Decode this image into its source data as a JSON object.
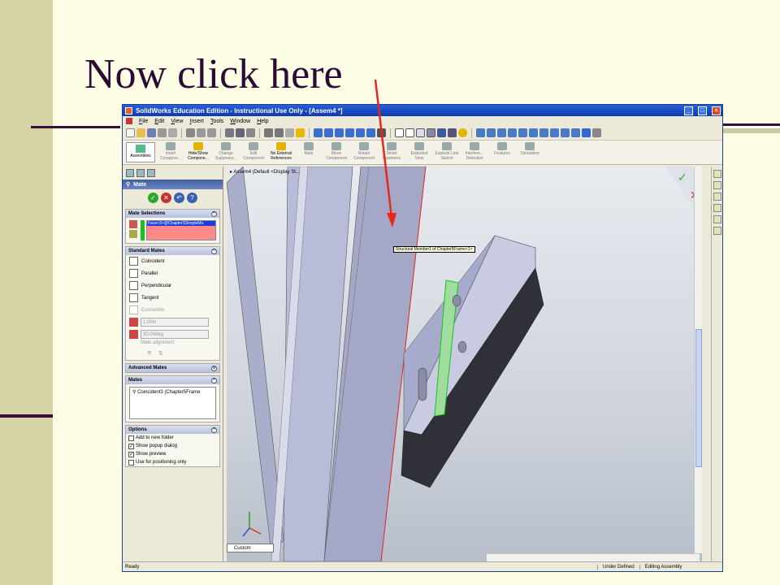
{
  "slide": {
    "title": "Now click here"
  },
  "window": {
    "title": "SolidWorks Education Edition - Instructional Use Only - [Assem4 *]",
    "min": "_",
    "max": "□",
    "close": "×"
  },
  "menu": [
    "File",
    "Edit",
    "View",
    "Insert",
    "Tools",
    "Window",
    "Help"
  ],
  "command_manager": {
    "assemblies": "Assemblies",
    "buttons": [
      {
        "label": "Insert Compone...",
        "active": false
      },
      {
        "label": "Hide/Show Compone...",
        "active": true
      },
      {
        "label": "Change Suppressi...",
        "active": false
      },
      {
        "label": "Edit Component",
        "active": false
      },
      {
        "label": "No External References",
        "active": true
      },
      {
        "label": "Mate",
        "active": false
      },
      {
        "label": "Move Component",
        "active": false
      },
      {
        "label": "Rotate Component",
        "active": false
      },
      {
        "label": "Smart Fasteners",
        "active": false
      },
      {
        "label": "Exploded View",
        "active": false
      },
      {
        "label": "Explode Line Sketch",
        "active": false
      },
      {
        "label": "Interfere... Detection",
        "active": false
      },
      {
        "label": "Features",
        "active": false
      },
      {
        "label": "Simulation",
        "active": false
      }
    ]
  },
  "property_manager": {
    "title": "Mate",
    "mate_selections": {
      "header": "Mate Selections",
      "item": "Face<3>@ChapterSSimpleMa"
    },
    "standard_mates": {
      "header": "Standard Mates",
      "items": [
        {
          "label": "Coincident",
          "enabled": true
        },
        {
          "label": "Parallel",
          "enabled": true
        },
        {
          "label": "Perpendicular",
          "enabled": true
        },
        {
          "label": "Tangent",
          "enabled": true
        },
        {
          "label": "Concentric",
          "enabled": false
        }
      ],
      "distance": "1.00in",
      "angle": "30.00deg",
      "alignment_label": "Mate alignment:"
    },
    "advanced_mates": {
      "header": "Advanced Mates"
    },
    "mates": {
      "header": "Mates",
      "item": "Coincident3 (Chapter5Frame"
    },
    "options": {
      "header": "Options",
      "items": [
        {
          "label": "Add to new folder",
          "checked": false
        },
        {
          "label": "Show popup dialog",
          "checked": true
        },
        {
          "label": "Show preview",
          "checked": true
        },
        {
          "label": "Use for positioning only",
          "checked": false
        }
      ]
    }
  },
  "graphics": {
    "tree_crumb": "Assem4 (Default <Display St...",
    "tooltip": "Structural Member1 of Chapter5Frame<1>",
    "view_field": "Custom"
  },
  "status": {
    "ready": "Ready",
    "state": "Under Defined",
    "mode": "Editing Assembly"
  },
  "colors": {
    "arrow": "#e8261e",
    "title": "#2b0b35",
    "slide_bg": "#fdfde6",
    "slide_sidebar": "#d4d3a4"
  }
}
